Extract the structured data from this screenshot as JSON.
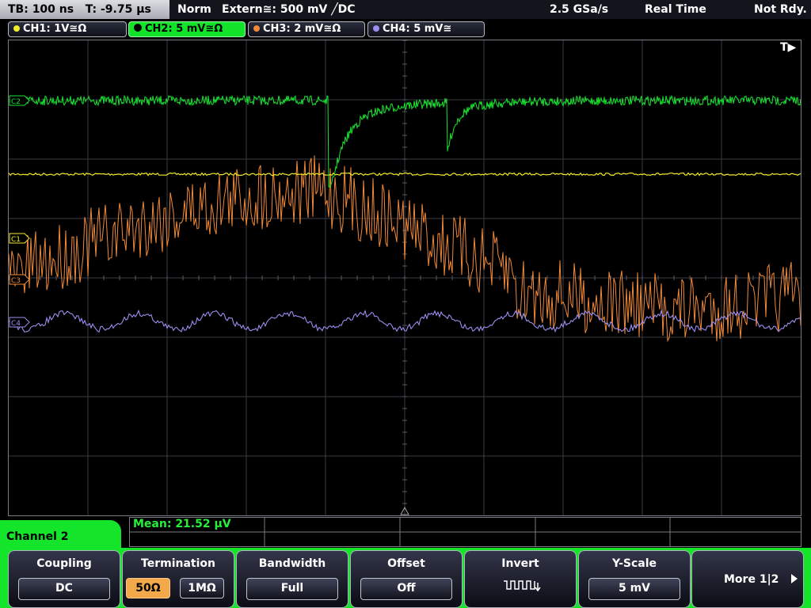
{
  "status_bar": {
    "timebase": "TB: 100 ns   T: -9.75 µs",
    "trigger_mode": "Norm",
    "trigger_source": "Extern≅: 500 mV ╱DC",
    "sample_rate": "2.5 GSa/s",
    "acq_mode": "Real Time",
    "state": "Not Rdy."
  },
  "channels": [
    {
      "label": "CH1: 1V≅Ω",
      "color": "#f3ec2a"
    },
    {
      "label": "CH2: 5 mV≅Ω",
      "color": "#18e530"
    },
    {
      "label": "CH3: 2 mV≅Ω",
      "color": "#f08a3a"
    },
    {
      "label": "CH4: 5 mV≅",
      "color": "#9a8ff0"
    }
  ],
  "screen": {
    "trigger_marker": "T▶",
    "markers": [
      "C1",
      "C3",
      "C4",
      "C2"
    ]
  },
  "measurement": {
    "text": "Mean: 21.52 µV"
  },
  "menu": {
    "title": "Channel 2",
    "coupling": {
      "label": "Coupling",
      "value": "DC"
    },
    "termination": {
      "label": "Termination",
      "options": [
        "50Ω",
        "1MΩ"
      ],
      "selected": "50Ω"
    },
    "bandwidth": {
      "label": "Bandwidth",
      "value": "Full"
    },
    "offset": {
      "label": "Offset",
      "value": "Off"
    },
    "invert": {
      "label": "Invert",
      "icon": "invert-waveform-icon"
    },
    "yscale": {
      "label": "Y-Scale",
      "value": "5 mV"
    },
    "more": {
      "label": "More 1|2"
    }
  }
}
